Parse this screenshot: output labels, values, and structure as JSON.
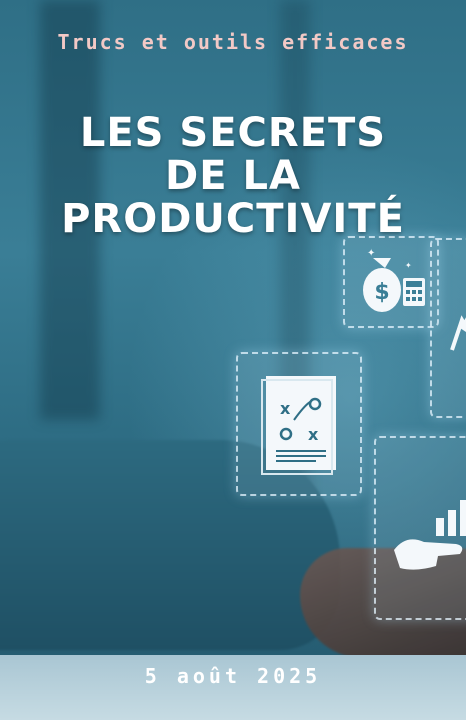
{
  "cover": {
    "subtitle": "Trucs et outils efficaces",
    "title_lines": [
      "Les secrets",
      "de la",
      "productivité"
    ],
    "date": "5 août 2025"
  },
  "colors": {
    "background": "#2f6f86",
    "subtitle_text": "#f2c9c6",
    "title_text": "#ffffff",
    "date_text": "#ffffff",
    "panel_outline": "#e6f5ff"
  },
  "icons": [
    "money-bag-calculator-icon",
    "strategy-document-icon",
    "hand-growth-chart-icon",
    "rising-arrow-icon"
  ]
}
